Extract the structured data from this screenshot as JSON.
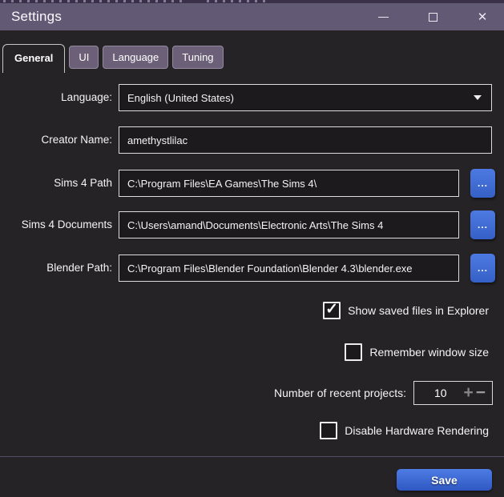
{
  "window": {
    "title": "Settings",
    "close_glyph": "✕"
  },
  "tabs": [
    {
      "label": "General",
      "active": true
    },
    {
      "label": "UI",
      "active": false
    },
    {
      "label": "Language",
      "active": false
    },
    {
      "label": "Tuning",
      "active": false
    }
  ],
  "form": {
    "language": {
      "label": "Language:",
      "value": "English (United States)"
    },
    "creator_name": {
      "label": "Creator Name:",
      "value": "amethystlilac"
    },
    "sims4_path": {
      "label": "Sims 4 Path",
      "value": "C:\\Program Files\\EA Games\\The Sims 4\\"
    },
    "sims4_documents": {
      "label": "Sims 4 Documents",
      "value": "C:\\Users\\amand\\Documents\\Electronic Arts\\The Sims 4"
    },
    "blender_path": {
      "label": "Blender Path:",
      "value": "C:\\Program Files\\Blender Foundation\\Blender 4.3\\blender.exe"
    },
    "checkboxes": [
      {
        "label": "Show saved files in Explorer",
        "checked": true
      },
      {
        "label": "Remember window size",
        "checked": false
      },
      {
        "label": "Disable Hardware Rendering",
        "checked": false
      }
    ],
    "recent_projects": {
      "label": "Number of recent projects:",
      "value": "10"
    },
    "save_label": "Save"
  },
  "icons": {
    "check": "✓",
    "browse": "...",
    "plus": "+",
    "minus": "−"
  },
  "colors": {
    "titlebar": "#625975",
    "background": "#262326",
    "accent_blue": "#3f6cd6",
    "tab_inactive": "#6b6078",
    "input_border": "#dcdcdc"
  }
}
